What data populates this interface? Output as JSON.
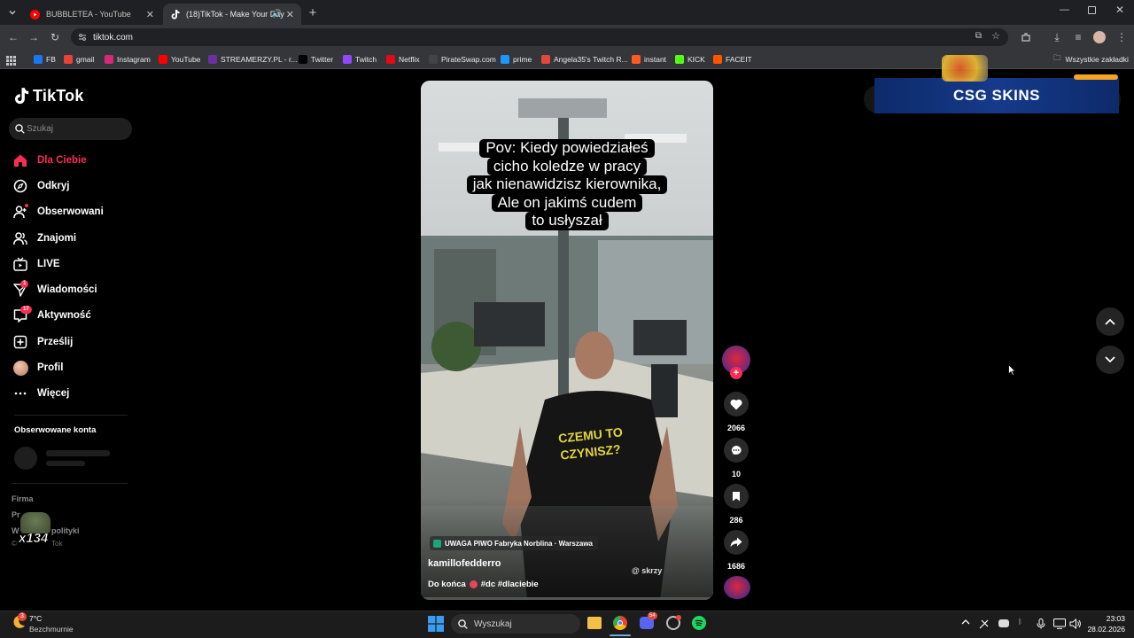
{
  "browser": {
    "tabs": [
      {
        "title": "BUBBLETEA - YouTube",
        "active": false
      },
      {
        "title": "(18)TikTok - Make Your Day",
        "active": true
      }
    ],
    "url": "tiktok.com",
    "bookmarks": [
      {
        "label": "FB",
        "color": "#1877f2"
      },
      {
        "label": "gmail",
        "color": "#ea4335"
      },
      {
        "label": "Instagram",
        "color": "#d62976"
      },
      {
        "label": "YouTube",
        "color": "#ff0000"
      },
      {
        "label": "STREAMERZY.PL - r...",
        "color": "#6b2fa0"
      },
      {
        "label": "Twitter",
        "color": "#000000"
      },
      {
        "label": "Twitch",
        "color": "#9146ff"
      },
      {
        "label": "Netflix",
        "color": "#e50914"
      },
      {
        "label": "PirateSwap.com",
        "color": "#444444"
      },
      {
        "label": "prime",
        "color": "#1a98ff"
      },
      {
        "label": "Angela35's Twitch R...",
        "color": "#e2483d"
      },
      {
        "label": "instant",
        "color": "#ff5a1f"
      },
      {
        "label": "KICK",
        "color": "#53fc18"
      },
      {
        "label": "FACEIT",
        "color": "#ff5500"
      }
    ],
    "all_bookmarks": "Wszystkie zakładki"
  },
  "tiktok": {
    "logo": "TikTok",
    "search_placeholder": "Szukaj",
    "nav": [
      {
        "label": "Dla Ciebie",
        "icon": "home-icon",
        "active": true
      },
      {
        "label": "Odkryj",
        "icon": "compass-icon"
      },
      {
        "label": "Obserwowani",
        "icon": "user-follow-icon"
      },
      {
        "label": "Znajomi",
        "icon": "friends-icon"
      },
      {
        "label": "LIVE",
        "icon": "live-icon"
      },
      {
        "label": "Wiadomości",
        "icon": "message-icon",
        "badge": "1"
      },
      {
        "label": "Aktywność",
        "icon": "activity-icon",
        "badge": "17"
      },
      {
        "label": "Prześlij",
        "icon": "upload-icon"
      },
      {
        "label": "Profil",
        "icon": "avatar-icon"
      },
      {
        "label": "Więcej",
        "icon": "more-icon"
      }
    ],
    "followed_header": "Obserwowane konta",
    "footer": {
      "company": "Firma",
      "program": "Pr",
      "terms": "W",
      "policy": "polityki",
      "copyright": "©",
      "copyright_tail": "Tok",
      "overlay": "x134"
    },
    "video": {
      "caption_lines": [
        "Pov: Kiedy powiedziałeś",
        "cicho koledze w pracy",
        "jak nienawidzisz kierownika,",
        "Ale on jakimś cudem",
        "to usłyszał"
      ],
      "shirt_text": "CZEMU TO CZYNISZ?",
      "location": "UWAGA PIWO Fabryka Norblina · Warszawa",
      "author": "kamillofedderro",
      "description": "Do końca",
      "hashtags": "#dc #dlaciebie",
      "watermark": "@ skrzy"
    },
    "actions": {
      "likes": "2066",
      "comments": "10",
      "saves": "286",
      "shares": "1686"
    },
    "ad_text": "CSG SKINS"
  },
  "taskbar": {
    "temperature": "7°C",
    "weather": "Bezchmurnie",
    "weather_badge": "3",
    "search_placeholder": "Wyszukaj",
    "time": "23:03",
    "date": "28.02.2026",
    "discord_badge": "54"
  }
}
